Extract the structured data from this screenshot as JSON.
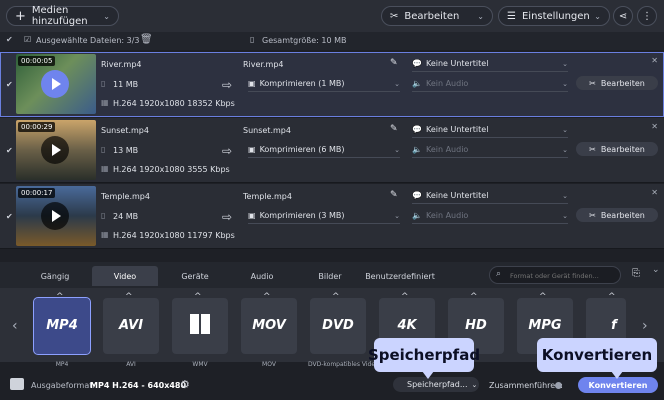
{
  "toolbar": {
    "add_media": "Medien hinzufügen",
    "edit": "Bearbeiten",
    "settings": "Einstellungen"
  },
  "selection": {
    "selected_files": "Ausgewählte Dateien: 3/3",
    "total_size": "Gesamtgröße: 10 MB"
  },
  "files": [
    {
      "duration": "00:00:05",
      "name": "River.mp4",
      "size": "11 MB",
      "codec": "H.264 1920x1080 18352 Kbps",
      "output_name": "River.mp4",
      "compress": "Komprimieren (1 MB)",
      "subtitle": "Keine Untertitel",
      "audio": "Kein Audio",
      "edit": "Bearbeiten"
    },
    {
      "duration": "00:00:29",
      "name": "Sunset.mp4",
      "size": "13 MB",
      "codec": "H.264 1920x1080 3555 Kbps",
      "output_name": "Sunset.mp4",
      "compress": "Komprimieren (6 MB)",
      "subtitle": "Keine Untertitel",
      "audio": "Kein Audio",
      "edit": "Bearbeiten"
    },
    {
      "duration": "00:00:17",
      "name": "Temple.mp4",
      "size": "24 MB",
      "codec": "H.264 1920x1080 11797 Kbps",
      "output_name": "Temple.mp4",
      "compress": "Komprimieren (3 MB)",
      "subtitle": "Keine Untertitel",
      "audio": "Kein Audio",
      "edit": "Bearbeiten"
    }
  ],
  "tabs": [
    "Gängig",
    "Video",
    "Geräte",
    "Audio",
    "Bilder",
    "Benutzerdefiniert"
  ],
  "search": {
    "placeholder": "Format oder Gerät finden..."
  },
  "formats": [
    {
      "label": "MP4",
      "caption": "MP4"
    },
    {
      "label": "AVI",
      "caption": "AVI"
    },
    {
      "label": "",
      "caption": "WMV"
    },
    {
      "label": "MOV",
      "caption": "MOV"
    },
    {
      "label": "DVD",
      "caption": "DVD-kompatibles Video"
    },
    {
      "label": "4K",
      "caption": ""
    },
    {
      "label": "HD",
      "caption": ""
    },
    {
      "label": "MPG",
      "caption": ""
    },
    {
      "label": "f",
      "caption": ""
    }
  ],
  "bottom": {
    "output_label": "Ausgabeformat:",
    "output_value": "MP4 H.264 - 640x480",
    "save_path": "Speicherpfad...",
    "merge": "Zusammenführen:",
    "convert": "Konvertieren"
  },
  "callouts": {
    "save_path": "Speicherpfad",
    "convert": "Konvertieren"
  }
}
